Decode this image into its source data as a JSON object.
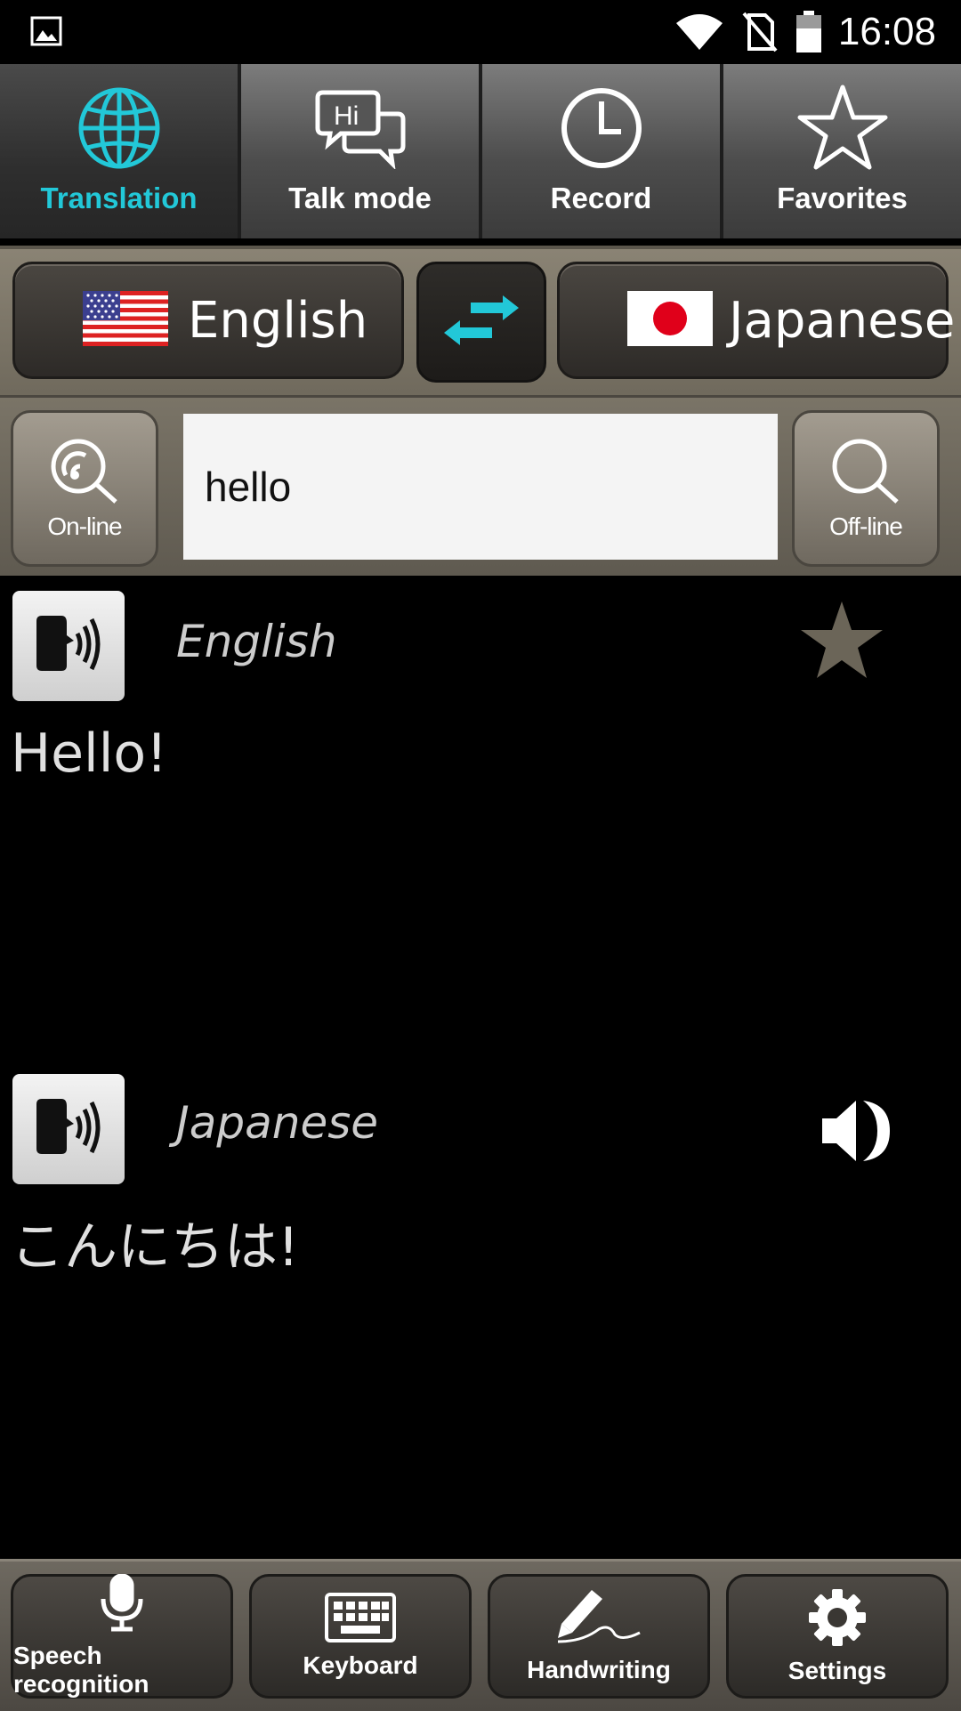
{
  "status_bar": {
    "time": "16:08",
    "icons": [
      "image-icon",
      "wifi-icon",
      "no-sim-icon",
      "battery-icon"
    ]
  },
  "tabs": [
    {
      "label": "Translation",
      "icon": "globe-icon",
      "active": true
    },
    {
      "label": "Talk mode",
      "icon": "chat-bubbles-icon",
      "active": false
    },
    {
      "label": "Record",
      "icon": "clock-icon",
      "active": false
    },
    {
      "label": "Favorites",
      "icon": "star-outline-icon",
      "active": false
    }
  ],
  "languages": {
    "source": "English",
    "target": "Japanese"
  },
  "search": {
    "online_label": "On-line",
    "offline_label": "Off-line",
    "input_value": "hello"
  },
  "results": [
    {
      "language": "English",
      "text": "Hello!",
      "action_icon": "star-filled-icon"
    },
    {
      "language": "Japanese",
      "text": "こんにちは!",
      "action_icon": "volume-icon"
    }
  ],
  "toolbar": {
    "speech": "Speech recognition",
    "keyboard": "Keyboard",
    "handwriting": "Handwriting",
    "settings": "Settings"
  },
  "colors": {
    "accent": "#22c8d8",
    "background": "#000000"
  }
}
